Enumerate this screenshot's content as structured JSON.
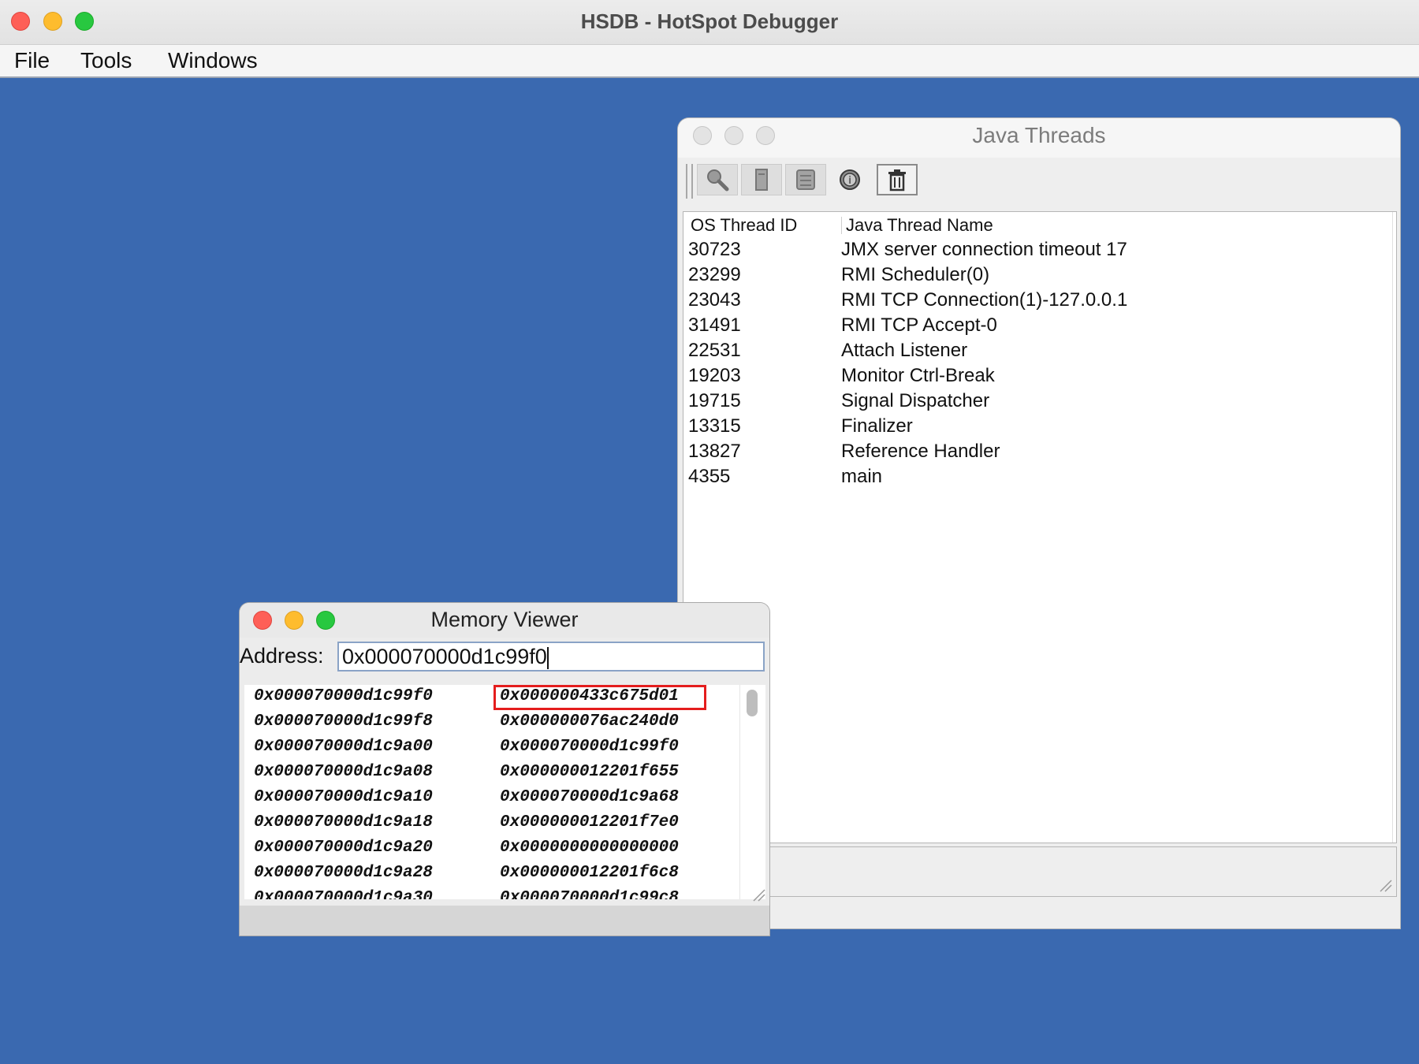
{
  "app": {
    "title": "HSDB - HotSpot Debugger"
  },
  "menubar": {
    "items": [
      "File",
      "Tools",
      "Windows"
    ]
  },
  "java_threads": {
    "title": "Java Threads",
    "toolbar_icons": [
      "inspect-icon",
      "stack-icon",
      "memory-icon",
      "info-icon",
      "trash-icon"
    ],
    "columns": [
      "OS Thread ID",
      "Java Thread Name"
    ],
    "rows": [
      {
        "id": "30723",
        "name": "JMX server connection timeout 17"
      },
      {
        "id": "23299",
        "name": "RMI Scheduler(0)"
      },
      {
        "id": "23043",
        "name": "RMI TCP Connection(1)-127.0.0.1"
      },
      {
        "id": "31491",
        "name": "RMI TCP Accept-0"
      },
      {
        "id": "22531",
        "name": "Attach Listener"
      },
      {
        "id": "19203",
        "name": "Monitor Ctrl-Break"
      },
      {
        "id": "19715",
        "name": "Signal Dispatcher"
      },
      {
        "id": "13315",
        "name": "Finalizer"
      },
      {
        "id": "13827",
        "name": "Reference Handler"
      },
      {
        "id": "4355",
        "name": "main"
      }
    ]
  },
  "memory_viewer": {
    "title": "Memory Viewer",
    "address_label": "Address:",
    "address_value": "0x000070000d1c99f0",
    "rows": [
      {
        "addr": "0x000070000d1c99f0",
        "value": "0x000000433c675d01",
        "highlighted": true
      },
      {
        "addr": "0x000070000d1c99f8",
        "value": "0x000000076ac240d0"
      },
      {
        "addr": "0x000070000d1c9a00",
        "value": "0x000070000d1c99f0"
      },
      {
        "addr": "0x000070000d1c9a08",
        "value": "0x000000012201f655"
      },
      {
        "addr": "0x000070000d1c9a10",
        "value": "0x000070000d1c9a68"
      },
      {
        "addr": "0x000070000d1c9a18",
        "value": "0x000000012201f7e0"
      },
      {
        "addr": "0x000070000d1c9a20",
        "value": "0x0000000000000000"
      },
      {
        "addr": "0x000070000d1c9a28",
        "value": "0x000000012201f6c8"
      },
      {
        "addr": "0x000070000d1c9a30",
        "value": "0x000070000d1c99c8"
      }
    ],
    "highlight_color": "#e41d1d"
  },
  "colors": {
    "desktop": "#3a69b0"
  }
}
